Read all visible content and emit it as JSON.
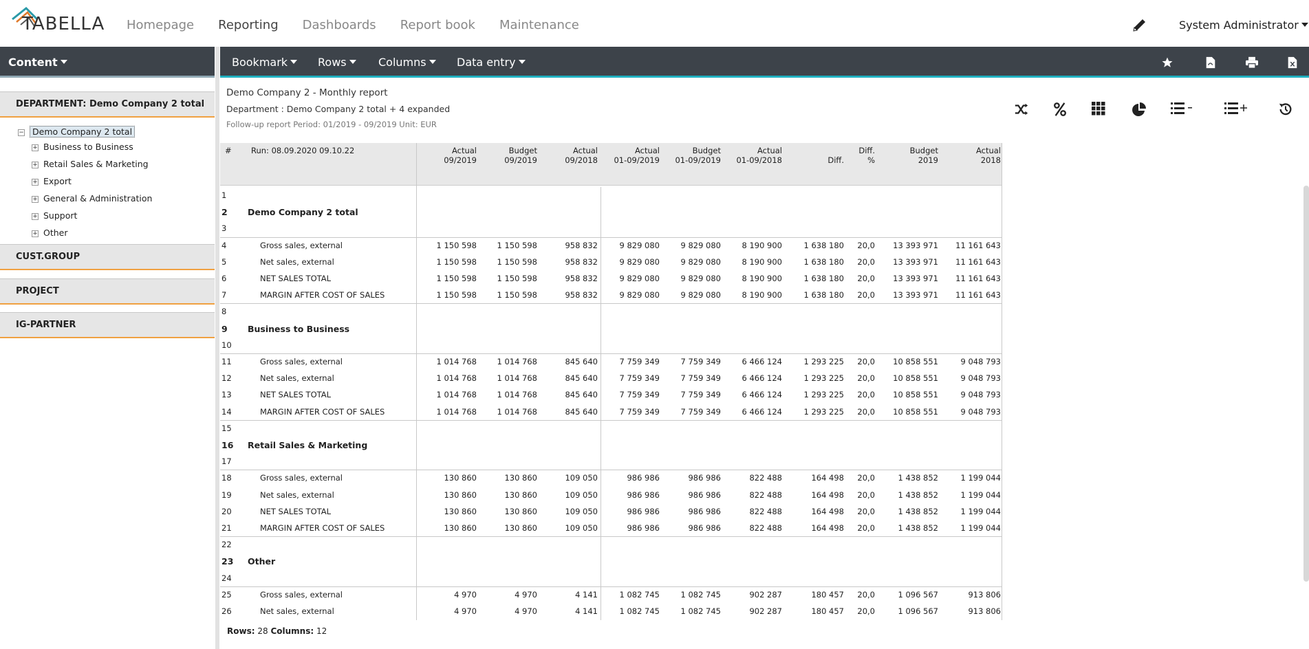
{
  "app": {
    "logo_text": "TABELLA"
  },
  "nav": {
    "links": [
      "Homepage",
      "Reporting",
      "Dashboards",
      "Report book",
      "Maintenance"
    ],
    "active": "Reporting",
    "user": "System Administrator"
  },
  "sidebar": {
    "content_label": "Content",
    "dimensions": [
      "DEPARTMENT: Demo Company 2 total",
      "CUST.GROUP",
      "PROJECT",
      "IG-PARTNER"
    ],
    "tree_root": "Demo Company 2 total",
    "tree_items": [
      "Business to Business",
      "Retail Sales & Marketing",
      "Export",
      "General & Administration",
      "Support",
      "Other"
    ]
  },
  "toolbar": {
    "menus": [
      "Bookmark",
      "Rows",
      "Columns",
      "Data entry"
    ]
  },
  "report": {
    "title": "Demo Company 2 - Monthly report",
    "department": "Department : Demo Company 2 total + 4 expanded",
    "meta": "Follow-up report Period: 01/2019 - 09/2019 Unit: EUR",
    "tools": [
      "shuffle-icon",
      "percent-icon",
      "grid-icon",
      "pie-chart-icon",
      "list-minus-icon",
      "list-plus-icon",
      "history-icon"
    ]
  },
  "table": {
    "hash": "#",
    "run": "Run: 08.09.2020 09.10.22",
    "columns": [
      [
        "Actual",
        "09/2019"
      ],
      [
        "Budget",
        "09/2019"
      ],
      [
        "Actual",
        "09/2018"
      ],
      [
        "Actual",
        "01-09/2019"
      ],
      [
        "Budget",
        "01-09/2019"
      ],
      [
        "Actual",
        "01-09/2018"
      ],
      [
        "",
        "Diff."
      ],
      [
        "Diff.",
        "%"
      ],
      [
        "Budget",
        "2019"
      ],
      [
        "Actual",
        "2018"
      ]
    ],
    "rows": [
      {
        "n": "1",
        "label": "",
        "type": "blank"
      },
      {
        "n": "2",
        "label": "Demo Company 2 total",
        "type": "group"
      },
      {
        "n": "3",
        "label": "",
        "type": "blank"
      },
      {
        "n": "4",
        "label": "Gross sales, external",
        "type": "data",
        "v": [
          "1 150 598",
          "1 150 598",
          "958 832",
          "9 829 080",
          "9 829 080",
          "8 190 900",
          "1 638 180",
          "20,0",
          "13 393 971",
          "11 161 643"
        ]
      },
      {
        "n": "5",
        "label": "Net sales, external",
        "type": "data",
        "v": [
          "1 150 598",
          "1 150 598",
          "958 832",
          "9 829 080",
          "9 829 080",
          "8 190 900",
          "1 638 180",
          "20,0",
          "13 393 971",
          "11 161 643"
        ]
      },
      {
        "n": "6",
        "label": "NET SALES TOTAL",
        "type": "data",
        "v": [
          "1 150 598",
          "1 150 598",
          "958 832",
          "9 829 080",
          "9 829 080",
          "8 190 900",
          "1 638 180",
          "20,0",
          "13 393 971",
          "11 161 643"
        ]
      },
      {
        "n": "7",
        "label": "MARGIN AFTER COST OF SALES",
        "type": "data",
        "v": [
          "1 150 598",
          "1 150 598",
          "958 832",
          "9 829 080",
          "9 829 080",
          "8 190 900",
          "1 638 180",
          "20,0",
          "13 393 971",
          "11 161 643"
        ]
      },
      {
        "n": "8",
        "label": "",
        "type": "blank"
      },
      {
        "n": "9",
        "label": "Business to Business",
        "type": "group"
      },
      {
        "n": "10",
        "label": "",
        "type": "blank"
      },
      {
        "n": "11",
        "label": "Gross sales, external",
        "type": "data",
        "v": [
          "1 014 768",
          "1 014 768",
          "845 640",
          "7 759 349",
          "7 759 349",
          "6 466 124",
          "1 293 225",
          "20,0",
          "10 858 551",
          "9 048 793"
        ]
      },
      {
        "n": "12",
        "label": "Net sales, external",
        "type": "data",
        "v": [
          "1 014 768",
          "1 014 768",
          "845 640",
          "7 759 349",
          "7 759 349",
          "6 466 124",
          "1 293 225",
          "20,0",
          "10 858 551",
          "9 048 793"
        ]
      },
      {
        "n": "13",
        "label": "NET SALES TOTAL",
        "type": "data",
        "v": [
          "1 014 768",
          "1 014 768",
          "845 640",
          "7 759 349",
          "7 759 349",
          "6 466 124",
          "1 293 225",
          "20,0",
          "10 858 551",
          "9 048 793"
        ]
      },
      {
        "n": "14",
        "label": "MARGIN AFTER COST OF SALES",
        "type": "data",
        "v": [
          "1 014 768",
          "1 014 768",
          "845 640",
          "7 759 349",
          "7 759 349",
          "6 466 124",
          "1 293 225",
          "20,0",
          "10 858 551",
          "9 048 793"
        ]
      },
      {
        "n": "15",
        "label": "",
        "type": "blank"
      },
      {
        "n": "16",
        "label": "Retail Sales & Marketing",
        "type": "group"
      },
      {
        "n": "17",
        "label": "",
        "type": "blank"
      },
      {
        "n": "18",
        "label": "Gross sales, external",
        "type": "data",
        "v": [
          "130 860",
          "130 860",
          "109 050",
          "986 986",
          "986 986",
          "822 488",
          "164 498",
          "20,0",
          "1 438 852",
          "1 199 044"
        ]
      },
      {
        "n": "19",
        "label": "Net sales, external",
        "type": "data",
        "v": [
          "130 860",
          "130 860",
          "109 050",
          "986 986",
          "986 986",
          "822 488",
          "164 498",
          "20,0",
          "1 438 852",
          "1 199 044"
        ]
      },
      {
        "n": "20",
        "label": "NET SALES TOTAL",
        "type": "data",
        "v": [
          "130 860",
          "130 860",
          "109 050",
          "986 986",
          "986 986",
          "822 488",
          "164 498",
          "20,0",
          "1 438 852",
          "1 199 044"
        ]
      },
      {
        "n": "21",
        "label": "MARGIN AFTER COST OF SALES",
        "type": "data",
        "v": [
          "130 860",
          "130 860",
          "109 050",
          "986 986",
          "986 986",
          "822 488",
          "164 498",
          "20,0",
          "1 438 852",
          "1 199 044"
        ]
      },
      {
        "n": "22",
        "label": "",
        "type": "blank"
      },
      {
        "n": "23",
        "label": "Other",
        "type": "group"
      },
      {
        "n": "24",
        "label": "",
        "type": "blank"
      },
      {
        "n": "25",
        "label": "Gross sales, external",
        "type": "data",
        "v": [
          "4 970",
          "4 970",
          "4 141",
          "1 082 745",
          "1 082 745",
          "902 287",
          "180 457",
          "20,0",
          "1 096 567",
          "913 806"
        ]
      },
      {
        "n": "26",
        "label": "Net sales, external",
        "type": "data",
        "v": [
          "4 970",
          "4 970",
          "4 141",
          "1 082 745",
          "1 082 745",
          "902 287",
          "180 457",
          "20,0",
          "1 096 567",
          "913 806"
        ]
      }
    ]
  },
  "footer": {
    "rows_label": "Rows:",
    "rows_value": "28",
    "cols_label": "Columns:",
    "cols_value": "12"
  }
}
